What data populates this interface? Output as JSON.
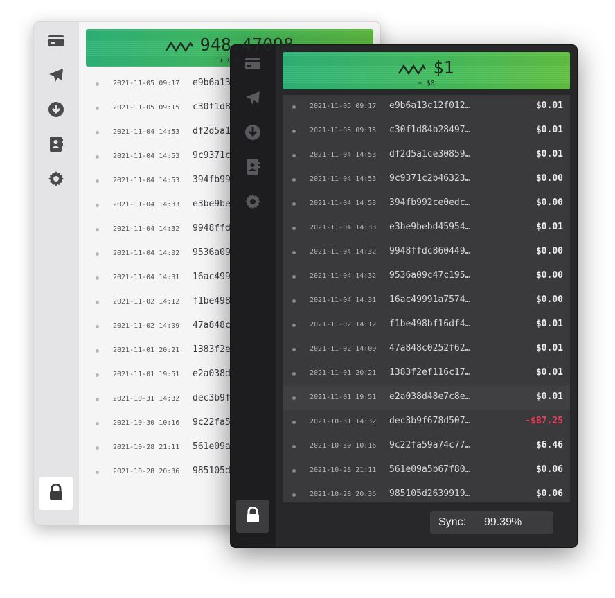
{
  "icons": {
    "nav": [
      "card-icon",
      "send-icon",
      "receive-icon",
      "contacts-icon",
      "gear-icon"
    ],
    "lock": "lock-icon"
  },
  "colors": {
    "accent_from": "#2fb57a",
    "accent_to": "#62c242",
    "negative": "#ef3a55"
  },
  "back_window": {
    "balance": "948.47098",
    "balance_sub": "+ 0.0",
    "transactions": [
      {
        "date": "2021-11-05 09:17",
        "hash": "e9b6a13"
      },
      {
        "date": "2021-11-05 09:15",
        "hash": "c30f1d8"
      },
      {
        "date": "2021-11-04 14:53",
        "hash": "df2d5a1"
      },
      {
        "date": "2021-11-04 14:53",
        "hash": "9c9371c"
      },
      {
        "date": "2021-11-04 14:53",
        "hash": "394fb99"
      },
      {
        "date": "2021-11-04 14:33",
        "hash": "e3be9be"
      },
      {
        "date": "2021-11-04 14:32",
        "hash": "9948ffd"
      },
      {
        "date": "2021-11-04 14:32",
        "hash": "9536a09"
      },
      {
        "date": "2021-11-04 14:31",
        "hash": "16ac499"
      },
      {
        "date": "2021-11-02 14:12",
        "hash": "f1be498"
      },
      {
        "date": "2021-11-02 14:09",
        "hash": "47a848c"
      },
      {
        "date": "2021-11-01 20:21",
        "hash": "1383f2e"
      },
      {
        "date": "2021-11-01 19:51",
        "hash": "e2a038d"
      },
      {
        "date": "2021-10-31 14:32",
        "hash": "dec3b9f"
      },
      {
        "date": "2021-10-30 10:16",
        "hash": "9c22fa5"
      },
      {
        "date": "2021-10-28 21:11",
        "hash": "561e09a"
      },
      {
        "date": "2021-10-28 20:36",
        "hash": "985105d"
      }
    ]
  },
  "front_window": {
    "balance": "$1",
    "balance_sub": "+ $0",
    "transactions": [
      {
        "date": "2021-11-05 09:17",
        "hash": "e9b6a13c12f012…",
        "amount": "$0.01"
      },
      {
        "date": "2021-11-05 09:15",
        "hash": "c30f1d84b28497…",
        "amount": "$0.01"
      },
      {
        "date": "2021-11-04 14:53",
        "hash": "df2d5a1ce30859…",
        "amount": "$0.01"
      },
      {
        "date": "2021-11-04 14:53",
        "hash": "9c9371c2b46323…",
        "amount": "$0.00"
      },
      {
        "date": "2021-11-04 14:53",
        "hash": "394fb992ce0edc…",
        "amount": "$0.00"
      },
      {
        "date": "2021-11-04 14:33",
        "hash": "e3be9bebd45954…",
        "amount": "$0.01"
      },
      {
        "date": "2021-11-04 14:32",
        "hash": "9948ffdc860449…",
        "amount": "$0.00"
      },
      {
        "date": "2021-11-04 14:32",
        "hash": "9536a09c47c195…",
        "amount": "$0.00"
      },
      {
        "date": "2021-11-04 14:31",
        "hash": "16ac49991a7574…",
        "amount": "$0.00"
      },
      {
        "date": "2021-11-02 14:12",
        "hash": "f1be498bf16df4…",
        "amount": "$0.01"
      },
      {
        "date": "2021-11-02 14:09",
        "hash": "47a848c0252f62…",
        "amount": "$0.01"
      },
      {
        "date": "2021-11-01 20:21",
        "hash": "1383f2ef116c17…",
        "amount": "$0.01"
      },
      {
        "date": "2021-11-01 19:51",
        "hash": "e2a038d48e7c8e…",
        "amount": "$0.01"
      },
      {
        "date": "2021-10-31 14:32",
        "hash": "dec3b9f678d507…",
        "amount": "-$87.25",
        "negative": true
      },
      {
        "date": "2021-10-30 10:16",
        "hash": "9c22fa59a74c77…",
        "amount": "$6.46"
      },
      {
        "date": "2021-10-28 21:11",
        "hash": "561e09a5b67f80…",
        "amount": "$0.06"
      },
      {
        "date": "2021-10-28 20:36",
        "hash": "985105d2639919…",
        "amount": "$0.06"
      }
    ],
    "sync_label": "Sync:",
    "sync_value": "99.39%"
  }
}
